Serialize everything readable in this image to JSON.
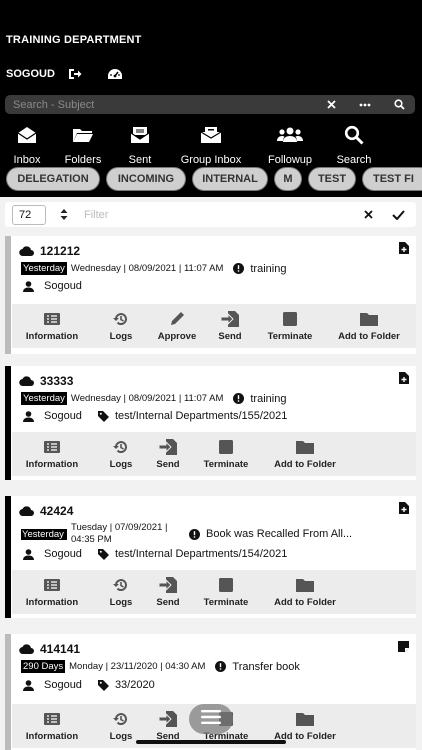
{
  "header": {
    "department": "TRAINING DEPARTMENT",
    "user": "SOGOUD",
    "search_placeholder": "Search - Subject"
  },
  "nav": [
    {
      "label": "Inbox",
      "icon": "inbox-icon"
    },
    {
      "label": "Folders",
      "icon": "folder-icon"
    },
    {
      "label": "Sent",
      "icon": "sent-icon"
    },
    {
      "label": "Group Inbox",
      "icon": "group-inbox-icon"
    },
    {
      "label": "Followup",
      "icon": "followup-icon"
    },
    {
      "label": "Search",
      "icon": "search-icon"
    }
  ],
  "chips": [
    "DELEGATION",
    "INCOMING",
    "INTERNAL",
    "M",
    "TEST",
    "TEST FI"
  ],
  "filter": {
    "count": "72",
    "placeholder": "Filter"
  },
  "cards": [
    {
      "id": "121212",
      "badge": "Yesterday",
      "date": "Wednesday | 08/09/2021 | 11:07 AM",
      "status": "training",
      "user": "Sogoud",
      "reference": "",
      "actions": [
        "Information",
        "Logs",
        "Approve",
        "Send",
        "Terminate",
        "Add to Folder"
      ]
    },
    {
      "id": "33333",
      "badge": "Yesterday",
      "date": "Wednesday | 08/09/2021 | 11:07 AM",
      "status": "training",
      "user": "Sogoud",
      "reference": "test/Internal Departments/155/2021",
      "actions": [
        "Information",
        "Logs",
        "Send",
        "Terminate",
        "Add to Folder"
      ]
    },
    {
      "id": "42424",
      "badge": "Yesterday",
      "date": "Tuesday | 07/09/2021 | 04:35 PM",
      "status": "Book was Recalled From All...",
      "user": "Sogoud",
      "reference": "test/Internal Departments/154/2021",
      "actions": [
        "Information",
        "Logs",
        "Send",
        "Terminate",
        "Add to Folder"
      ]
    },
    {
      "id": "414141",
      "badge": "290 Days",
      "date": "Monday | 23/11/2020 | 04:30 AM",
      "status": "Transfer book",
      "user": "Sogoud",
      "reference": "33/2020",
      "actions": [
        "Information",
        "Logs",
        "Send",
        "Terminate",
        "Add to Folder"
      ]
    }
  ]
}
